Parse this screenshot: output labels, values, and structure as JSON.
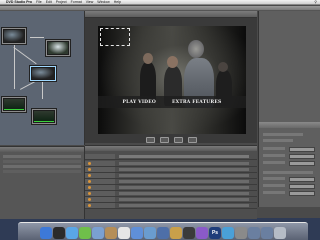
{
  "app": {
    "name": "DVD Studio Pro",
    "apple_menu": "",
    "menus": [
      "DVD Studio Pro",
      "File",
      "Edit",
      "Project",
      "Format",
      "View",
      "Window",
      "Help"
    ]
  },
  "menu": {
    "buttons": [
      "PLAY VIDEO",
      "EXTRA FEATURES"
    ]
  },
  "dock": {
    "icons": [
      {
        "name": "finder-icon",
        "color": "#3d79d8",
        "glyph": ""
      },
      {
        "name": "dashboard-icon",
        "color": "#2b2b2b",
        "glyph": ""
      },
      {
        "name": "safari-icon",
        "color": "#5aa6e6",
        "glyph": ""
      },
      {
        "name": "ichat-icon",
        "color": "#6fbf4a",
        "glyph": ""
      },
      {
        "name": "mail-icon",
        "color": "#7aa0d2",
        "glyph": ""
      },
      {
        "name": "address-book-icon",
        "color": "#b58e58",
        "glyph": ""
      },
      {
        "name": "ical-icon",
        "color": "#e6e6e6",
        "glyph": ""
      },
      {
        "name": "itunes-icon",
        "color": "#5f8fd8",
        "glyph": ""
      },
      {
        "name": "iphoto-icon",
        "color": "#6a9ccf",
        "glyph": ""
      },
      {
        "name": "imovie-icon",
        "color": "#4e6fa8",
        "glyph": ""
      },
      {
        "name": "garageband-icon",
        "color": "#c9a04a",
        "glyph": ""
      },
      {
        "name": "final-cut-icon",
        "color": "#3b3b3b",
        "glyph": ""
      },
      {
        "name": "motion-icon",
        "color": "#8a5ac8",
        "glyph": ""
      },
      {
        "name": "photoshop-icon",
        "color": "#1f3d7a",
        "glyph": "Ps"
      },
      {
        "name": "dvd-studio-pro-icon",
        "color": "#4aa0d8",
        "glyph": ""
      },
      {
        "name": "system-preferences-icon",
        "color": "#8a8a8a",
        "glyph": ""
      },
      {
        "name": "downloads-stack-icon",
        "color": "#6a7fa0",
        "glyph": ""
      },
      {
        "name": "documents-stack-icon",
        "color": "#6a7fa0",
        "glyph": ""
      },
      {
        "name": "trash-icon",
        "color": "#b5bcc6",
        "glyph": ""
      }
    ]
  }
}
